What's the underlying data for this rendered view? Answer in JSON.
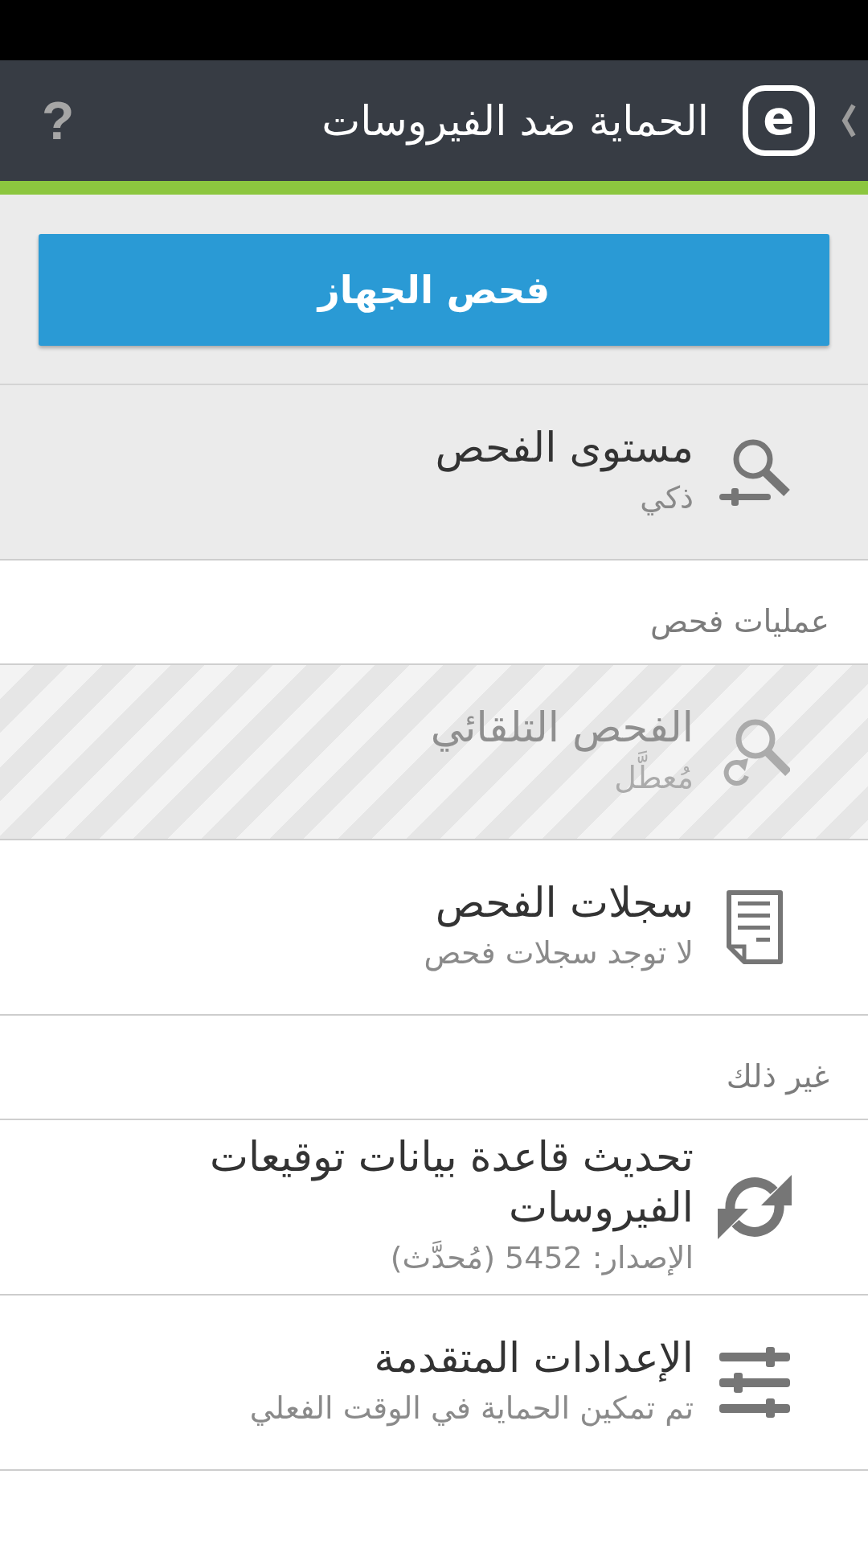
{
  "header": {
    "title": "الحماية ضد الفيروسات",
    "logo_letter": "e",
    "help_label": "?"
  },
  "scan_panel": {
    "button": "فحص الجهاز",
    "setting": {
      "kind": "scan_level",
      "title": "مستوى الفحص",
      "subtitle": "ذكي",
      "disabled": false
    }
  },
  "sections": [
    {
      "heading": "عمليات فحص",
      "items": [
        {
          "kind": "auto_scan",
          "title": "الفحص التلقائي",
          "subtitle": "مُعطَّل",
          "disabled": true
        },
        {
          "kind": "logs",
          "title": "سجلات الفحص",
          "subtitle": "لا توجد سجلات فحص",
          "disabled": false
        }
      ]
    },
    {
      "heading": "غير ذلك",
      "items": [
        {
          "kind": "update",
          "title": "تحديث قاعدة بيانات توقيعات الفيروسات",
          "subtitle": "الإصدار: 5452 (مُحدَّث)",
          "disabled": false
        },
        {
          "kind": "advanced",
          "title": "الإعدادات المتقدمة",
          "subtitle": "تم تمكين الحماية في الوقت الفعلي",
          "disabled": false
        }
      ]
    }
  ]
}
